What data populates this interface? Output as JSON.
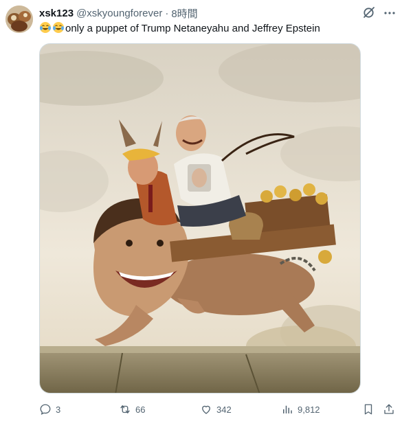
{
  "post": {
    "display_name": "xsk123",
    "handle": "@xskyoungforever",
    "separator": "·",
    "time": "8時間",
    "text": "only a puppet of Trump Netaneyahu and Jeffrey Epstein",
    "emoji": [
      "face-with-tears-of-joy",
      "face-with-tears-of-joy"
    ]
  },
  "media": {
    "description_icon": "illustration",
    "background_color": "#ece3d2"
  },
  "actions": {
    "replies": "3",
    "reposts": "66",
    "likes": "342",
    "views": "9,812"
  },
  "colors": {
    "text_primary": "#0f1419",
    "text_secondary": "#536471",
    "border": "#cfd9de"
  }
}
